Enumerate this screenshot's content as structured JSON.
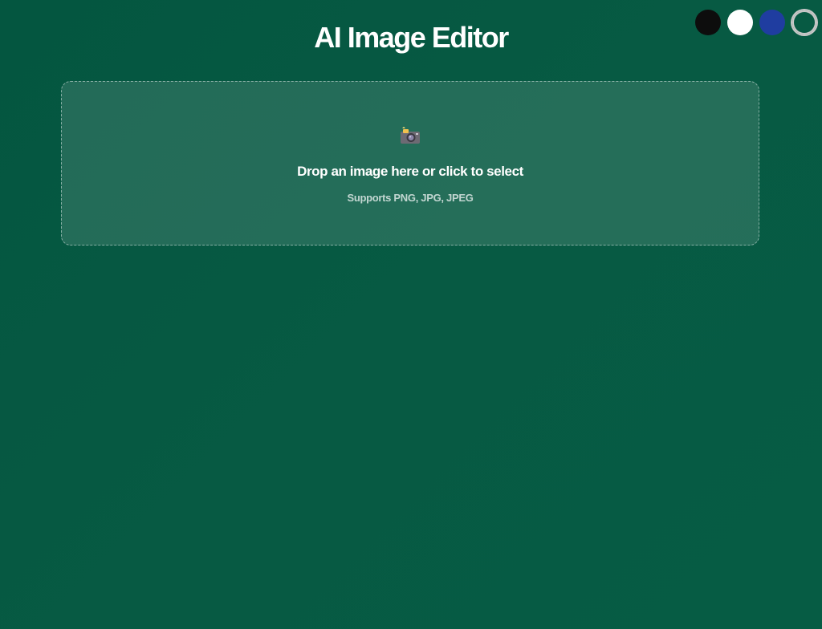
{
  "app": {
    "title": "AI Image Editor"
  },
  "theme": {
    "swatches": [
      {
        "name": "black",
        "color": "#0d0d0d",
        "active": false
      },
      {
        "name": "white",
        "color": "#ffffff",
        "active": false
      },
      {
        "name": "blue",
        "color": "#1f3da0",
        "active": false
      },
      {
        "name": "green",
        "color": "#075a43",
        "active": true
      }
    ]
  },
  "upload": {
    "icon": "camera-icon",
    "prompt": "Drop an image here or click to select",
    "formats": "Supports PNG, JPG, JPEG"
  },
  "colors": {
    "background": "#065a42",
    "accent": "#ffffff"
  }
}
